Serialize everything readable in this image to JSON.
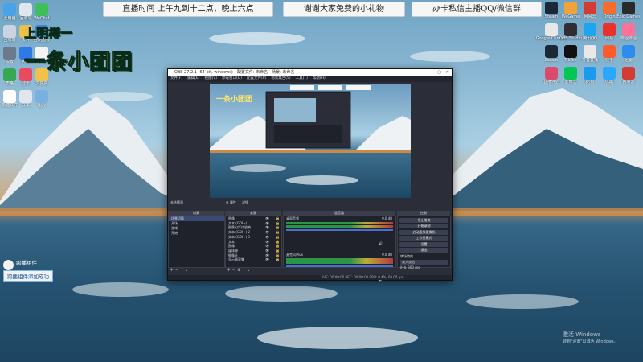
{
  "stream_overlay": {
    "banner_schedule": "直播时间 上午九到十二点，晚上六点",
    "banner_thanks": "谢谢大家免费的小礼物",
    "banner_contact": "办卡私信主播QQ/微信群",
    "small_title": "上明樽一",
    "big_title": "一条小团团",
    "chat_user": "跨播组件",
    "chat_message": "跨播组件添加成功"
  },
  "desktop_icons_left": [
    {
      "label": "此电脑",
      "color": "#4aa3e8"
    },
    {
      "label": "回收站",
      "color": "#dfe6ee"
    },
    {
      "label": "WeChat",
      "color": "#3fbf5a"
    },
    {
      "label": "回收站",
      "color": "#c9d4e0"
    },
    {
      "label": "文件",
      "color": "#e8c04a"
    },
    {
      "label": "控制面板",
      "color": "#3d7fd6"
    },
    {
      "label": "设置",
      "color": "#6b7b8c"
    },
    {
      "label": "腾讯",
      "color": "#2f78e8"
    },
    {
      "label": "文档",
      "color": "#f4f4f4"
    },
    {
      "label": "表格",
      "color": "#35a852"
    },
    {
      "label": "音乐",
      "color": "#e84a5f"
    },
    {
      "label": "文件夹",
      "color": "#f0c24a"
    },
    {
      "label": "新建文件",
      "color": "#ffffff"
    },
    {
      "label": "文本",
      "color": "#dfe6ee"
    },
    {
      "label": "图片",
      "color": "#78b0e0"
    }
  ],
  "desktop_icons_right": [
    {
      "label": "Steam",
      "color": "#1b2838"
    },
    {
      "label": "WeGame",
      "color": "#f0a33a"
    },
    {
      "label": "网易云",
      "color": "#d43c33"
    },
    {
      "label": "Origin",
      "color": "#f56c2d"
    },
    {
      "label": "Epic Games",
      "color": "#2a2a2a"
    },
    {
      "label": "Google Chrome",
      "color": "#e8e8e8"
    },
    {
      "label": "OBS Studio",
      "color": "#302e31"
    },
    {
      "label": "腾讯QQ",
      "color": "#1ea5f0"
    },
    {
      "label": "网易",
      "color": "#e8322d"
    },
    {
      "label": "哔哩哔哩",
      "color": "#fb7299"
    },
    {
      "label": "Steam",
      "color": "#1b2838"
    },
    {
      "label": "TikTok",
      "color": "#111111"
    },
    {
      "label": "抖音直播",
      "color": "#e8e8e8"
    },
    {
      "label": "快手",
      "color": "#ff5b2d"
    },
    {
      "label": "迅雷",
      "color": "#2d8cf0"
    },
    {
      "label": "直播伴侣",
      "color": "#d94b6b"
    },
    {
      "label": "爱奇艺",
      "color": "#00c853"
    },
    {
      "label": "酷狗",
      "color": "#1a9bf0"
    },
    {
      "label": "优酷",
      "color": "#2aa8ff"
    },
    {
      "label": "网易云",
      "color": "#d43c33"
    }
  ],
  "obs": {
    "title": "OBS 27.2.1 (64-bit, windows) - 配置文件: 未命名 - 场景: 未命名",
    "menu": [
      "文件(F)",
      "编辑(E)",
      "视图(V)",
      "停靠窗口(D)",
      "配置文件(P)",
      "场景集合(S)",
      "工具(T)",
      "帮助(H)"
    ],
    "no_source_label": "未选择源",
    "toolbar_props": "属性",
    "toolbar_filters": "滤镜",
    "panels": {
      "scenes": "场景",
      "sources": "来源",
      "mixer": "混音器",
      "transitions": "转场特效",
      "controls": "控制"
    },
    "scenes": [
      "场景切换",
      "开场",
      "游戏",
      "开始"
    ],
    "sources": [
      "图像",
      "文本 (GDI+)",
      "图像幻灯片放映",
      "文本 (GDI+) 2",
      "文本 (GDI+) 3",
      "文本",
      "图像",
      "媒体源",
      "摄像头",
      "显示器采集"
    ],
    "mixer_channels": [
      {
        "name": "桌面音频",
        "level": "0.0 dB"
      },
      {
        "name": "麦克风/Aux",
        "level": "0.0 dB"
      }
    ],
    "controls": [
      "停止推流",
      "开始录制",
      "启动虚拟摄像机",
      "工作室模式",
      "设置",
      "退出"
    ],
    "transition_type": "淡入淡出",
    "transition_duration_label": "时长",
    "transition_duration": "300 ms",
    "status": "LIVE: 00:00:00   REC: 00:00:00   CPU: 0.4%, 60.00 fps"
  },
  "watermark": {
    "line1": "激活 Windows",
    "line2": "转到\"设置\"以激活 Windows。"
  },
  "icon_names": [
    "wechat-icon",
    "obs-icon",
    "steam-icon",
    "chrome-icon",
    "qq-icon",
    "gear-icon",
    "plus-icon",
    "minus-icon",
    "up-icon",
    "down-icon",
    "eye-icon",
    "lock-icon",
    "speaker-icon"
  ]
}
